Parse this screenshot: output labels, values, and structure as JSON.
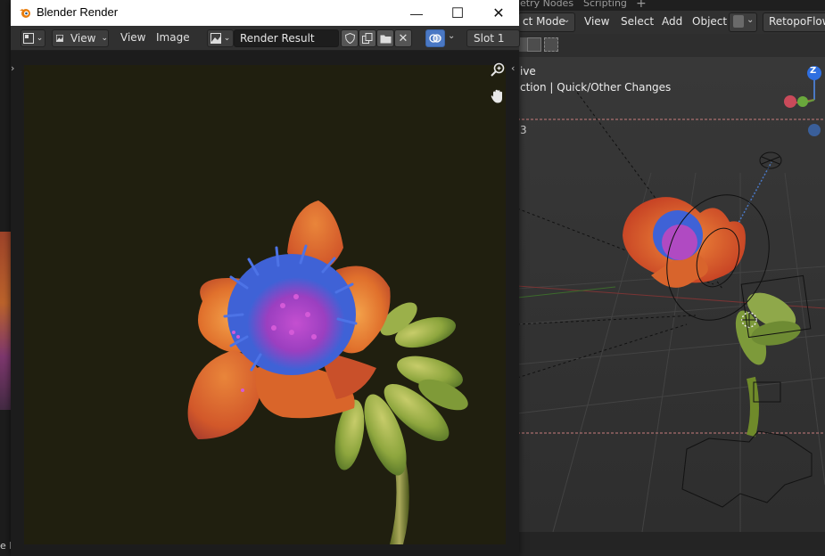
{
  "background_app": {
    "workspace_tabs": [
      "etry Nodes",
      "Scripting",
      "+"
    ],
    "mode_label": "ct Mode",
    "menu": [
      "View",
      "Select",
      "Add",
      "Object"
    ],
    "addon_label": "RetopoFlow",
    "viewport_info": {
      "line1": "ive",
      "line2": "ction | Quick/Other Changes",
      "line3": "3"
    },
    "gizmo_axis_label": "Z",
    "left_edge_label": "e N"
  },
  "popup": {
    "title": "Blender Render",
    "window_controls": {
      "minimize": "—",
      "maximize": "☐",
      "close": "✕"
    },
    "header": {
      "view_dropdown": "View",
      "view_menu": "View",
      "image_menu": "Image",
      "image_name": "Render Result",
      "slot": "Slot 1"
    }
  },
  "colors": {
    "accent_blue": "#4a78c4",
    "render_background": "#201f0f",
    "petal_orange": "#e0702c",
    "stamen_blue": "#3f62d6",
    "stamen_pink": "#c04fc9",
    "leaf_green": "#7d9a3a"
  },
  "icons": [
    "editor-type-icon",
    "image-icon",
    "shield-icon",
    "duplicate-icon",
    "folder-icon",
    "close-x-icon",
    "display-mode-icon",
    "zoom-in-icon",
    "hand-pan-icon",
    "chevron-right-icon",
    "chevron-left-icon"
  ]
}
